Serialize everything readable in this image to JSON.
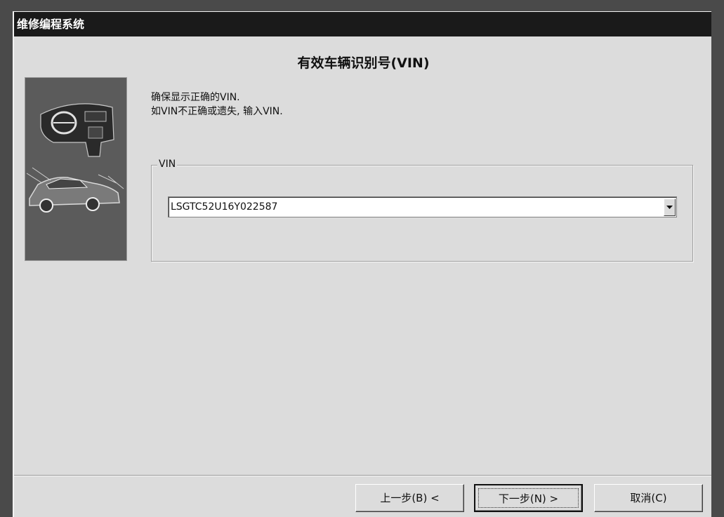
{
  "window": {
    "title": "维修编程系统"
  },
  "wizard": {
    "heading": "有效车辆识别号(VIN)",
    "instructions": [
      "确保显示正确的VIN.",
      "如VIN不正确或遗失, 输入VIN."
    ]
  },
  "vin_group": {
    "legend": "VIN",
    "selected_value": "LSGTC52U16Y022587"
  },
  "buttons": {
    "back": "上一步(B) <",
    "next": "下一步(N) >",
    "cancel": "取消(C)"
  },
  "icons": {
    "side_images": [
      "car-interior-icon",
      "car-side-icon"
    ],
    "dropdown": "chevron-down-icon"
  }
}
